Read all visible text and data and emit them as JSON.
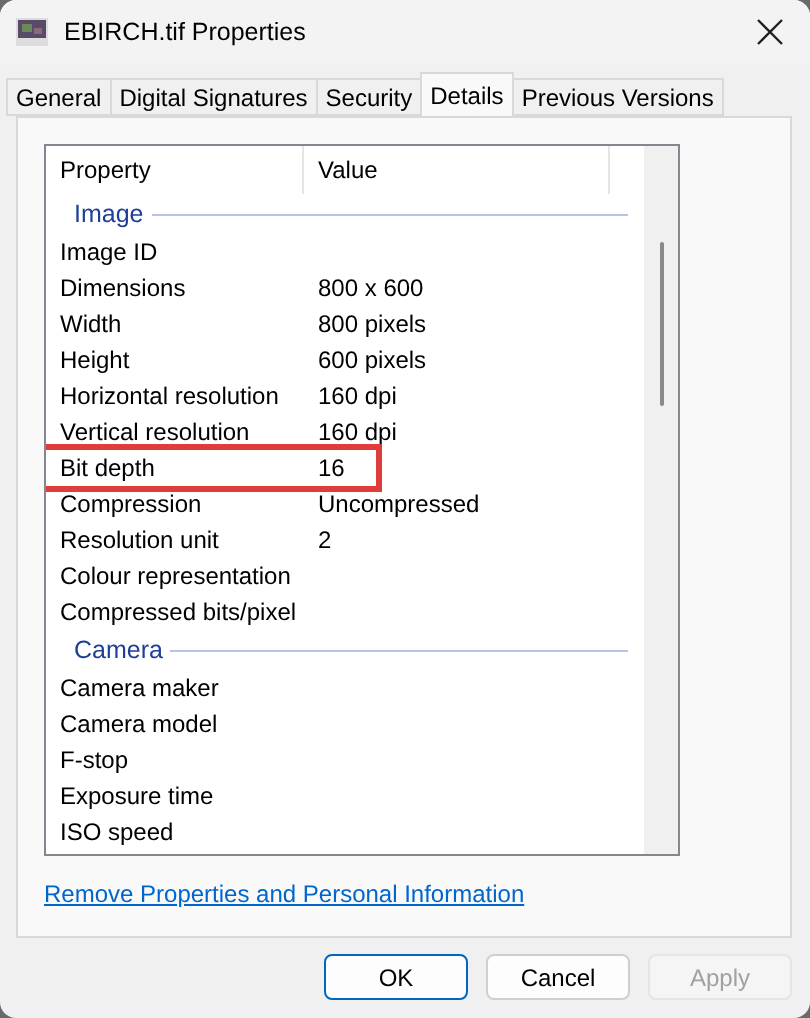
{
  "window": {
    "title": "EBIRCH.tif Properties"
  },
  "tabs": [
    {
      "label": "General",
      "selected": false
    },
    {
      "label": "Digital Signatures",
      "selected": false
    },
    {
      "label": "Security",
      "selected": false
    },
    {
      "label": "Details",
      "selected": true
    },
    {
      "label": "Previous Versions",
      "selected": false
    }
  ],
  "columns": [
    "Property",
    "Value"
  ],
  "sections": [
    {
      "title": "Image",
      "rows": [
        {
          "property": "Image ID",
          "value": "",
          "highlighted": false
        },
        {
          "property": "Dimensions",
          "value": "800 x 600",
          "highlighted": false
        },
        {
          "property": "Width",
          "value": "800 pixels",
          "highlighted": false
        },
        {
          "property": "Height",
          "value": "600 pixels",
          "highlighted": false
        },
        {
          "property": "Horizontal resolution",
          "value": "160 dpi",
          "highlighted": false
        },
        {
          "property": "Vertical resolution",
          "value": "160 dpi",
          "highlighted": false
        },
        {
          "property": "Bit depth",
          "value": "16",
          "highlighted": true
        },
        {
          "property": "Compression",
          "value": "Uncompressed",
          "highlighted": false
        },
        {
          "property": "Resolution unit",
          "value": "2",
          "highlighted": false
        },
        {
          "property": "Colour representation",
          "value": "",
          "highlighted": false
        },
        {
          "property": "Compressed bits/pixel",
          "value": "",
          "highlighted": false
        }
      ]
    },
    {
      "title": "Camera",
      "rows": [
        {
          "property": "Camera maker",
          "value": "",
          "highlighted": false
        },
        {
          "property": "Camera model",
          "value": "",
          "highlighted": false
        },
        {
          "property": "F-stop",
          "value": "",
          "highlighted": false
        },
        {
          "property": "Exposure time",
          "value": "",
          "highlighted": false
        },
        {
          "property": "ISO speed",
          "value": "",
          "highlighted": false
        }
      ]
    }
  ],
  "link": "Remove Properties and Personal Information",
  "buttons": [
    {
      "label": "OK",
      "disabled": false,
      "default": true
    },
    {
      "label": "Cancel",
      "disabled": false,
      "default": false
    },
    {
      "label": "Apply",
      "disabled": true,
      "default": false
    }
  ]
}
